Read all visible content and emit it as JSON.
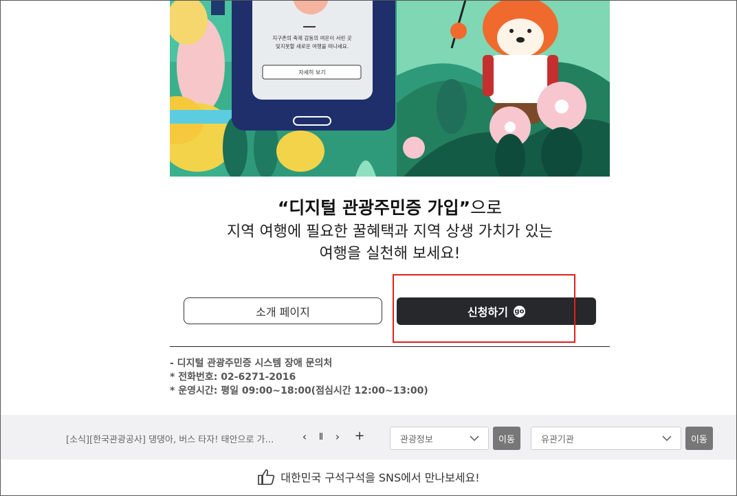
{
  "hero": {
    "phone_card": {
      "line1": "지구촌의 축제 감동의 여운이 서린 곳",
      "line2": "잊지못할 새로운 여행을 떠나세요.",
      "button_label": "자세히 보기"
    }
  },
  "headline": {
    "quote_text": "“디지털 관광주민증 가입”",
    "suffix": "으로",
    "line2": "지역 여행에 필요한 꿀혜택과 지역 상생 가치가 있는",
    "line3": "여행을 실천해 보세요!"
  },
  "buttons": {
    "intro_label": "소개 페이지",
    "apply_label": "신청하기",
    "go_badge": "go"
  },
  "contact": {
    "title": "- 디지털 관광주민증 시스템 장애 문의처",
    "phone": "* 전화번호: 02-6271-2016",
    "hours": "* 운영시간: 평일 09:00~18:00(점심시간 12:00~13:00)"
  },
  "footer_bar": {
    "news_text": "[소식][한국관광공사] 댕댕아, 버스 타자! 태안으로 가…",
    "controls": {
      "prev": "‹",
      "pause": "Ⅱ",
      "next": "›",
      "more": "+"
    },
    "select1": {
      "value": "관광정보"
    },
    "move1_label": "이동",
    "select2": {
      "value": "유관기관"
    },
    "move2_label": "이동"
  },
  "sns": {
    "text": "대한민국 구석구석을 SNS에서 만나보세요!",
    "icon": "thumbs-up-icon"
  },
  "colors": {
    "apply_bg": "#26282c",
    "highlight": "#e0201c",
    "footer_bg": "#f1f1f3",
    "move_bg": "#777777"
  }
}
